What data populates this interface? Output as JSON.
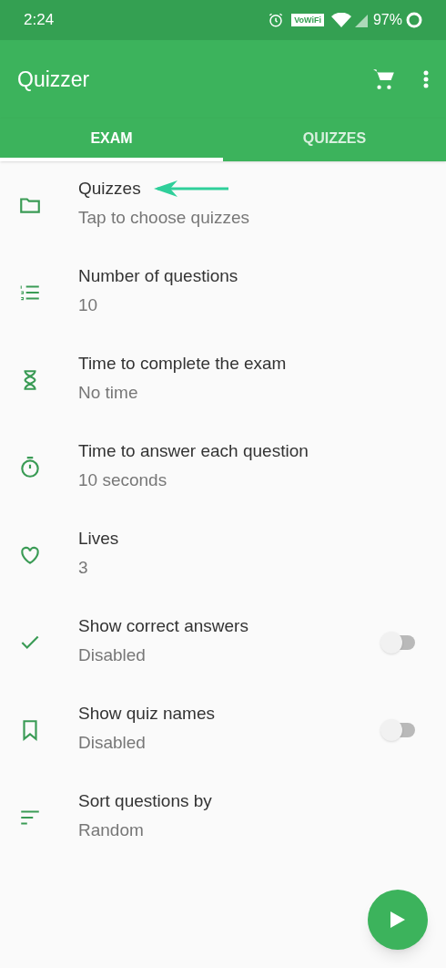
{
  "status_bar": {
    "time": "2:24",
    "vowifi": "VoWiFi",
    "battery": "97%"
  },
  "app_bar": {
    "title": "Quizzer"
  },
  "tabs": [
    {
      "label": "EXAM",
      "selected": true
    },
    {
      "label": "QUIZZES",
      "selected": false
    }
  ],
  "settings": [
    {
      "kind": "text",
      "title": "Quizzes",
      "value": "Tap to choose quizzes"
    },
    {
      "kind": "text",
      "title": "Number of questions",
      "value": "10"
    },
    {
      "kind": "text",
      "title": "Time to complete the exam",
      "value": "No time"
    },
    {
      "kind": "text",
      "title": "Time to answer each question",
      "value": "10 seconds"
    },
    {
      "kind": "text",
      "title": "Lives",
      "value": "3"
    },
    {
      "kind": "toggle",
      "title": "Show correct answers",
      "value": "Disabled",
      "on": false
    },
    {
      "kind": "toggle",
      "title": "Show quiz names",
      "value": "Disabled",
      "on": false
    },
    {
      "kind": "text",
      "title": "Sort questions by",
      "value": "Random"
    }
  ]
}
